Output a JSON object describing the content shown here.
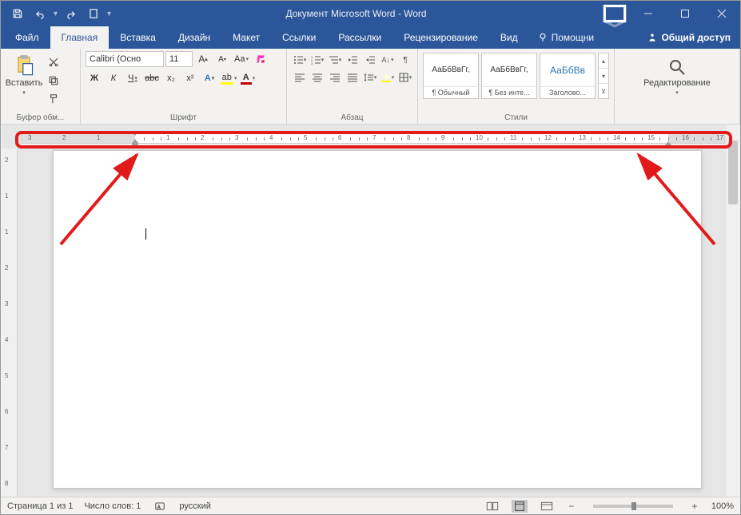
{
  "title": "Документ Microsoft Word - Word",
  "tabs": {
    "file": "Файл",
    "home": "Главная",
    "insert": "Вставка",
    "design": "Дизайн",
    "layout": "Макет",
    "references": "Ссылки",
    "mailings": "Рассылки",
    "review": "Рецензирование",
    "view": "Вид"
  },
  "tell_me": "Помощни",
  "share": "Общий доступ",
  "ribbon": {
    "clipboard": {
      "label": "Буфер обм...",
      "paste": "Вставить"
    },
    "font": {
      "label": "Шрифт",
      "name": "Calibri (Осно",
      "size": "11",
      "bold": "Ж",
      "italic": "К",
      "underline": "Ч",
      "strike": "abc",
      "sub": "x₂",
      "sup": "x²"
    },
    "paragraph": {
      "label": "Абзац"
    },
    "styles": {
      "label": "Стили",
      "items": [
        {
          "preview": "АаБбВвГг,",
          "name": "¶ Обычный"
        },
        {
          "preview": "АаБбВвГг,",
          "name": "¶ Без инте..."
        },
        {
          "preview": "АаБбВв",
          "name": "Заголово..."
        }
      ]
    },
    "editing": {
      "label": "Редактирование"
    }
  },
  "ruler": {
    "left_margin_nums": [
      "3",
      "2",
      "1"
    ],
    "body_nums": [
      "1",
      "2",
      "3",
      "4",
      "5",
      "6",
      "7",
      "8",
      "9",
      "10",
      "11",
      "12",
      "13",
      "14",
      "15",
      "16",
      "17"
    ]
  },
  "vruler": [
    "2",
    "1",
    "1",
    "2",
    "3",
    "4",
    "5",
    "6",
    "7",
    "8"
  ],
  "status": {
    "page": "Страница 1 из 1",
    "words": "Число слов: 1",
    "lang": "русский",
    "zoom": "100%"
  }
}
